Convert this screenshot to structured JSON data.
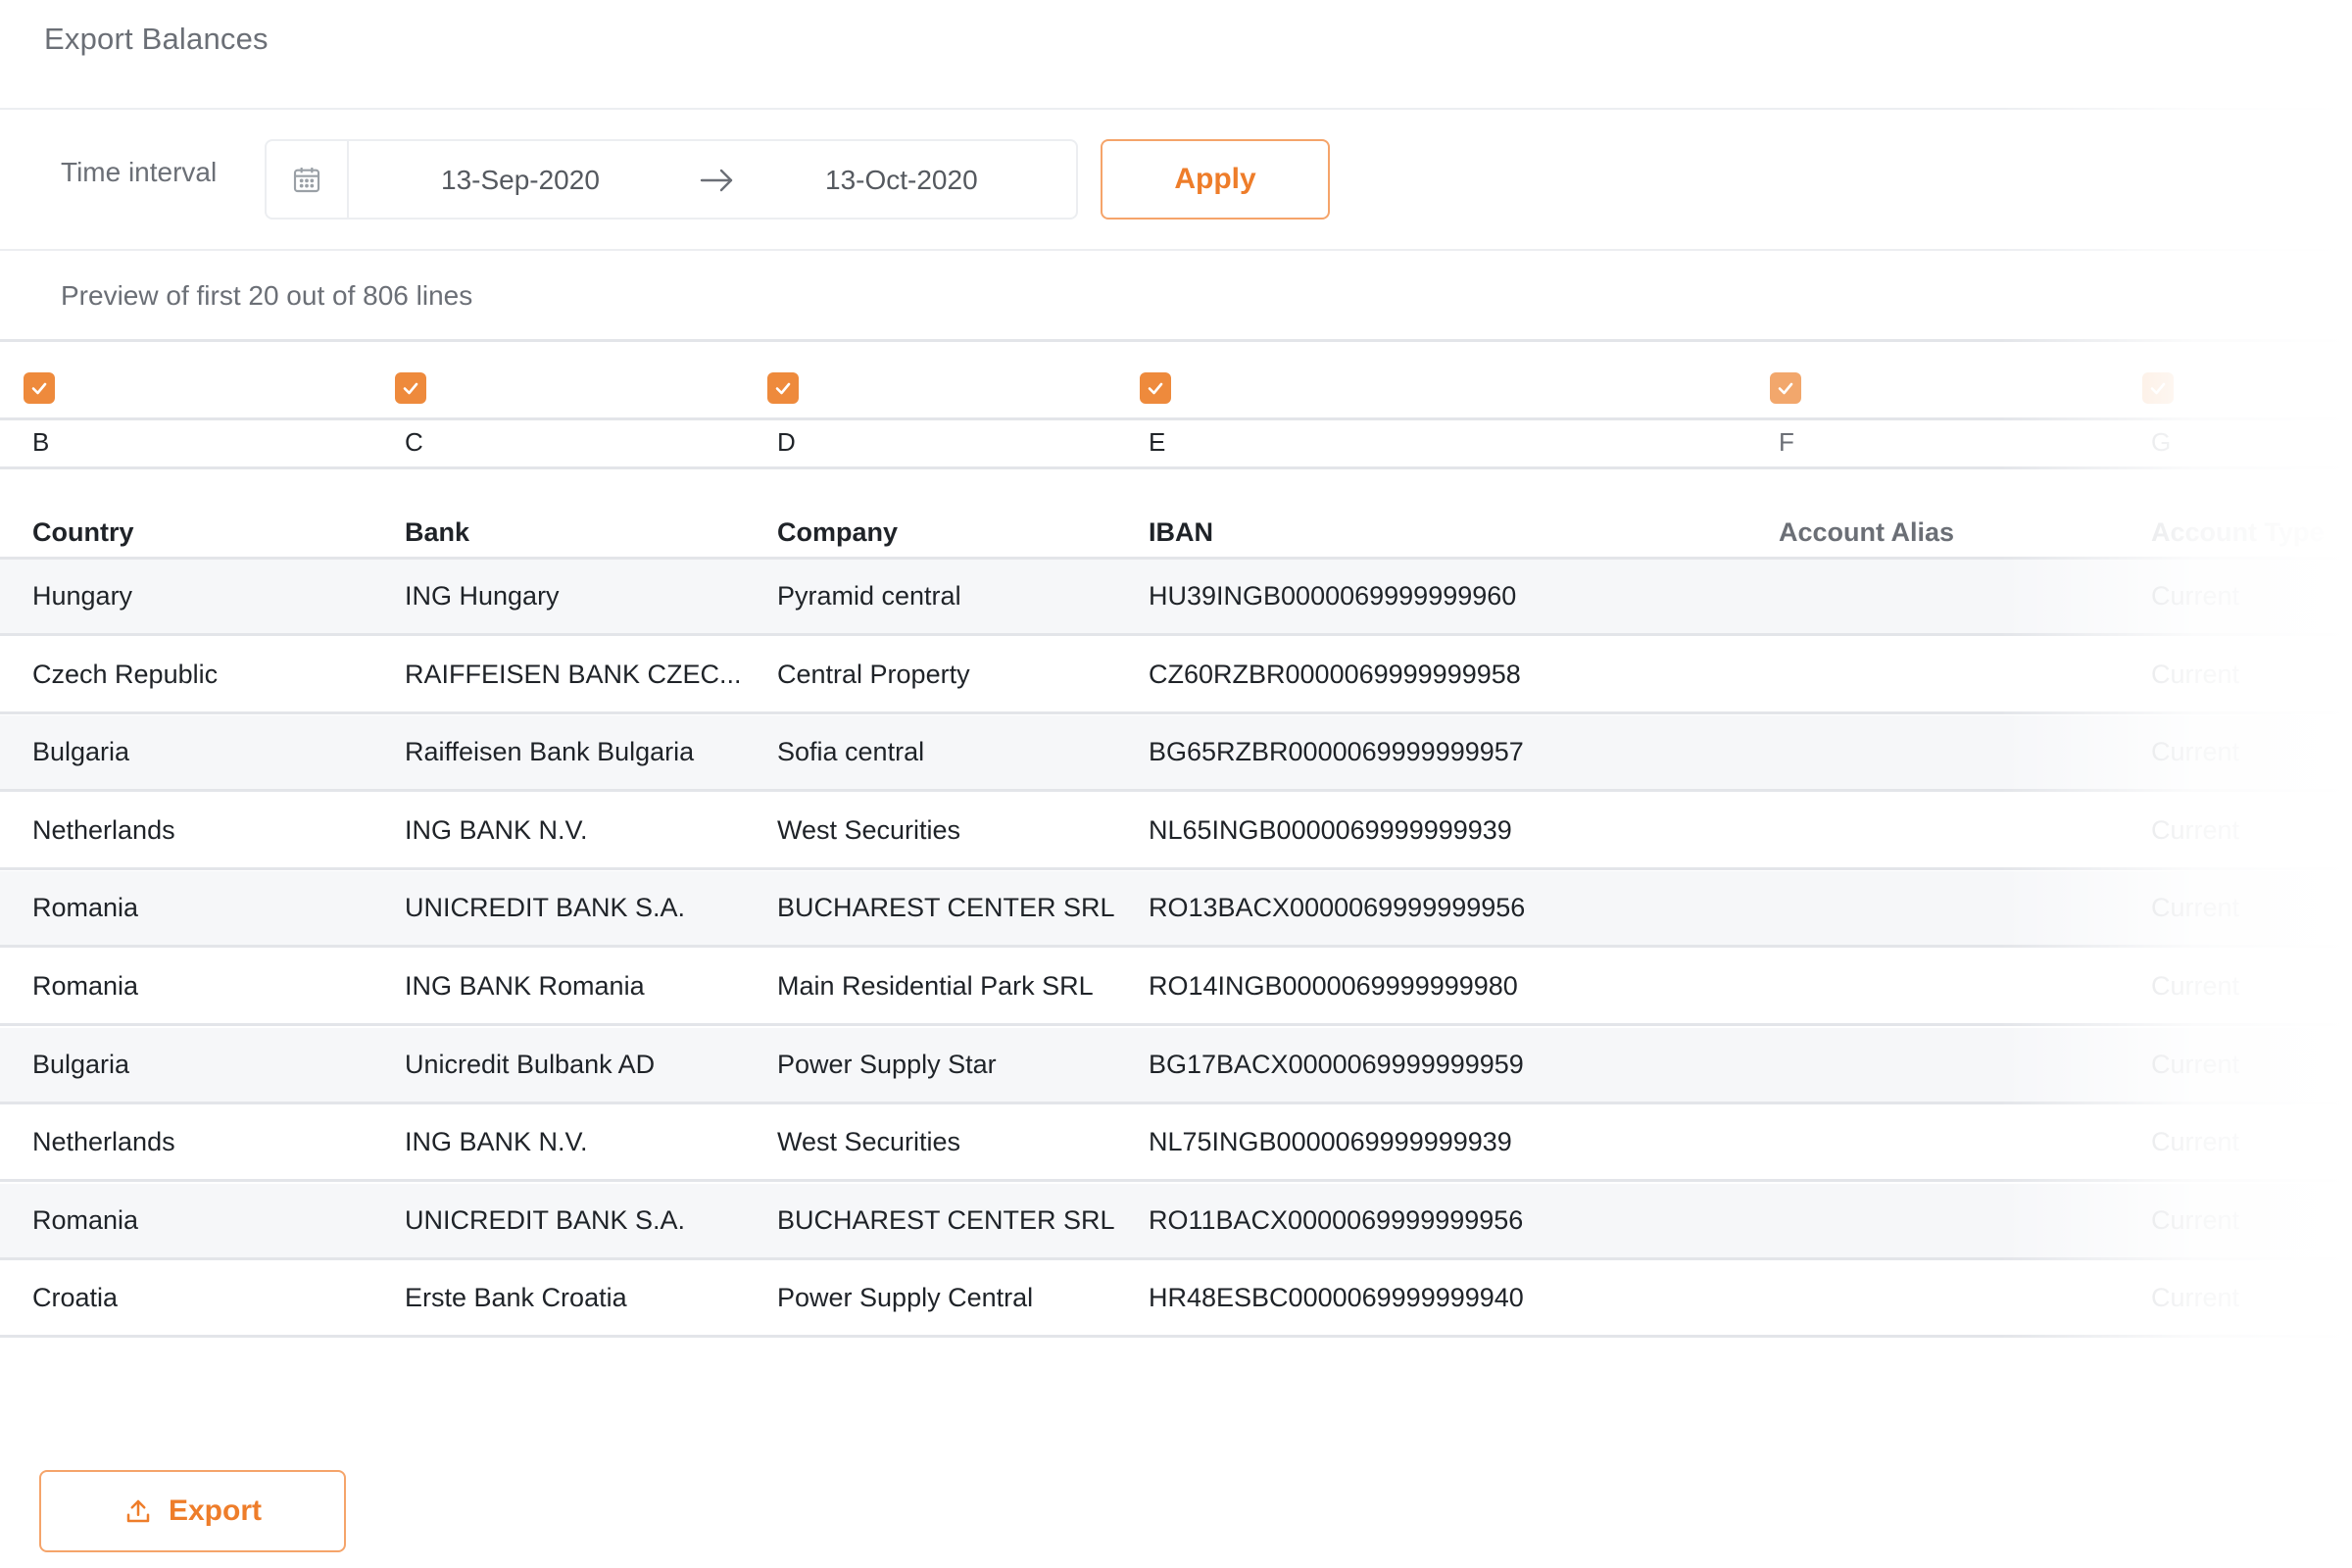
{
  "page": {
    "title": "Export Balances"
  },
  "filter": {
    "label": "Time interval",
    "date_from": "13-Sep-2020",
    "date_to": "13-Oct-2020",
    "apply_label": "Apply"
  },
  "preview": {
    "text": "Preview of first 20 out of 806 lines"
  },
  "columns": [
    {
      "letter": "B",
      "header": "Country",
      "checked": true
    },
    {
      "letter": "C",
      "header": "Bank",
      "checked": true
    },
    {
      "letter": "D",
      "header": "Company",
      "checked": true
    },
    {
      "letter": "E",
      "header": "IBAN",
      "checked": true
    },
    {
      "letter": "F",
      "header": "Account Alias",
      "checked": true
    },
    {
      "letter": "G",
      "header": "Account Type",
      "checked": true
    }
  ],
  "rows": [
    [
      "Hungary",
      "ING Hungary",
      "Pyramid central",
      "HU39INGB0000069999999960",
      "",
      "Current"
    ],
    [
      "Czech Republic",
      "RAIFFEISEN BANK CZEC...",
      "Central Property",
      "CZ60RZBR0000069999999958",
      "",
      "Current"
    ],
    [
      "Bulgaria",
      "Raiffeisen Bank Bulgaria",
      "Sofia central",
      "BG65RZBR0000069999999957",
      "",
      "Current"
    ],
    [
      "Netherlands",
      "ING BANK N.V.",
      "West Securities",
      "NL65INGB0000069999999939",
      "",
      "Current"
    ],
    [
      "Romania",
      "UNICREDIT BANK S.A.",
      "BUCHAREST CENTER SRL",
      "RO13BACX0000069999999956",
      "",
      "Current"
    ],
    [
      "Romania",
      "ING BANK Romania",
      "Main Residential Park SRL",
      "RO14INGB0000069999999980",
      "",
      "Current"
    ],
    [
      "Bulgaria",
      "Unicredit Bulbank AD",
      "Power Supply Star",
      "BG17BACX0000069999999959",
      "",
      "Current"
    ],
    [
      "Netherlands",
      "ING BANK N.V.",
      "West Securities",
      "NL75INGB0000069999999939",
      "",
      "Current"
    ],
    [
      "Romania",
      "UNICREDIT BANK S.A.",
      "BUCHAREST CENTER SRL",
      "RO11BACX0000069999999956",
      "",
      "Current"
    ],
    [
      "Croatia",
      "Erste Bank Croatia",
      "Power Supply Central",
      "HR48ESBC0000069999999940",
      "",
      "Current"
    ]
  ],
  "export": {
    "label": "Export"
  },
  "icons": {
    "calendar": "calendar-icon",
    "arrow": "arrow-right-icon",
    "checkbox": "checkbox-checked-icon",
    "upload": "upload-icon"
  },
  "colors": {
    "accent": "#ee7d2a",
    "checkbox": "#ee8a3c",
    "row_alt": "#f6f7f9",
    "border": "#e3e5e9"
  }
}
